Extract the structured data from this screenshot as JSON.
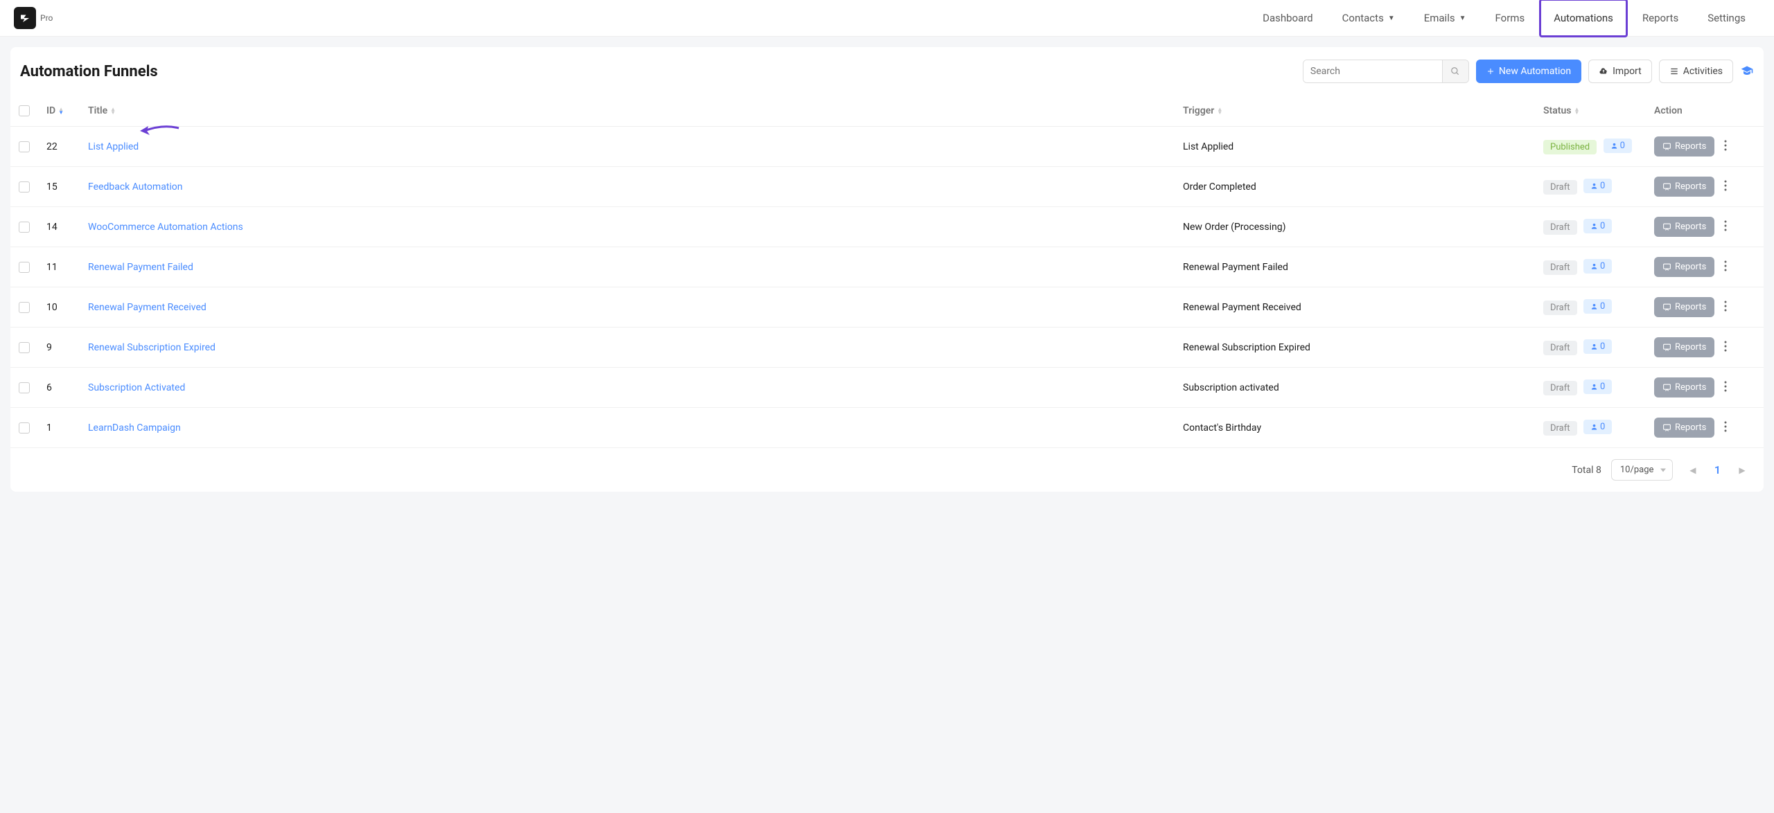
{
  "logo_label": "Pro",
  "nav": {
    "dashboard": "Dashboard",
    "contacts": "Contacts",
    "emails": "Emails",
    "forms": "Forms",
    "automations": "Automations",
    "reports": "Reports",
    "settings": "Settings"
  },
  "page_title": "Automation Funnels",
  "search_placeholder": "Search",
  "buttons": {
    "new": "New Automation",
    "import": "Import",
    "activities": "Activities",
    "reports": "Reports"
  },
  "columns": {
    "id": "ID",
    "title": "Title",
    "trigger": "Trigger",
    "status": "Status",
    "action": "Action"
  },
  "rows": [
    {
      "id": "22",
      "title": "List Applied",
      "trigger": "List Applied",
      "status": "Published",
      "status_type": "green",
      "count": "0",
      "highlight": true
    },
    {
      "id": "15",
      "title": "Feedback Automation",
      "trigger": "Order Completed",
      "status": "Draft",
      "status_type": "gray",
      "count": "0"
    },
    {
      "id": "14",
      "title": "WooCommerce Automation Actions",
      "trigger": "New Order (Processing)",
      "status": "Draft",
      "status_type": "gray",
      "count": "0"
    },
    {
      "id": "11",
      "title": "Renewal Payment Failed",
      "trigger": "Renewal Payment Failed",
      "status": "Draft",
      "status_type": "gray",
      "count": "0"
    },
    {
      "id": "10",
      "title": "Renewal Payment Received",
      "trigger": "Renewal Payment Received",
      "status": "Draft",
      "status_type": "gray",
      "count": "0"
    },
    {
      "id": "9",
      "title": "Renewal Subscription Expired",
      "trigger": "Renewal Subscription Expired",
      "status": "Draft",
      "status_type": "gray",
      "count": "0"
    },
    {
      "id": "6",
      "title": "Subscription Activated",
      "trigger": "Subscription activated",
      "status": "Draft",
      "status_type": "gray",
      "count": "0"
    },
    {
      "id": "1",
      "title": "LearnDash Campaign",
      "trigger": "Contact's Birthday",
      "status": "Draft",
      "status_type": "gray",
      "count": "0"
    }
  ],
  "pagination": {
    "total": "Total 8",
    "per_page": "10/page",
    "current": "1"
  }
}
